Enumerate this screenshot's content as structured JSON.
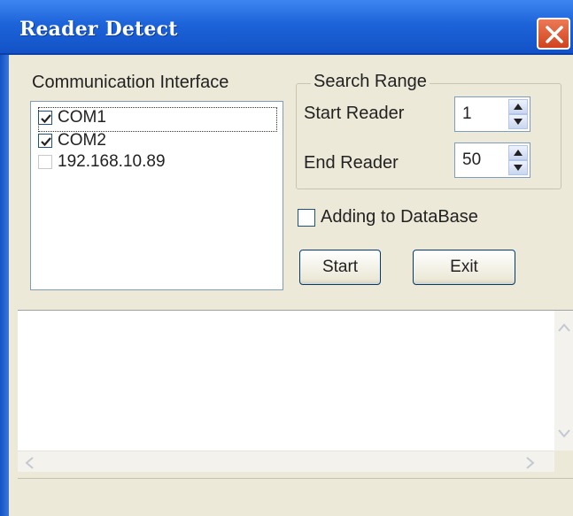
{
  "window": {
    "title": "Reader Detect"
  },
  "communication_interface": {
    "label": "Communication Interface",
    "items": [
      {
        "label": "COM1",
        "checked": true
      },
      {
        "label": "COM2",
        "checked": true
      },
      {
        "label": "192.168.10.89",
        "checked": false
      }
    ]
  },
  "search_range": {
    "label": "Search Range",
    "start_reader": {
      "label": "Start Reader",
      "value": "1"
    },
    "end_reader": {
      "label": "End Reader",
      "value": "50"
    }
  },
  "options": {
    "add_to_database_label": "Adding to DataBase",
    "add_to_database_checked": false
  },
  "buttons": {
    "start": "Start",
    "exit": "Exit"
  },
  "icons": {
    "close": "close-icon",
    "check": "checkmark-icon",
    "spin_up": "triangle-up-icon",
    "spin_down": "triangle-down-icon",
    "scroll_up": "chevron-up-icon",
    "scroll_down": "chevron-down-icon",
    "scroll_left": "chevron-left-icon",
    "scroll_right": "chevron-right-icon"
  },
  "colors": {
    "title_bar": "#1d63d9",
    "close_button": "#d1421e",
    "dialog_face": "#ece9d8"
  }
}
